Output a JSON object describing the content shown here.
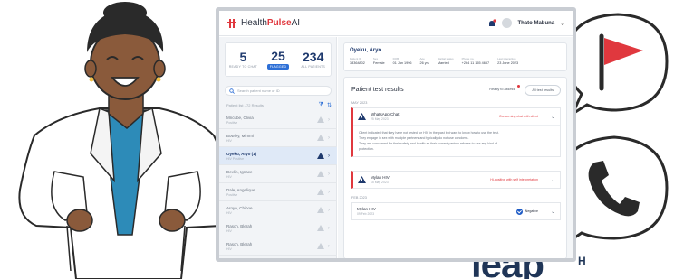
{
  "app": {
    "brand_prefix": "Health",
    "brand_highlight": "Pulse",
    "brand_suffix": " AI",
    "user_name": "Thato Mabuna"
  },
  "stats": [
    {
      "value": "5",
      "label": "Ready to chat"
    },
    {
      "value": "25",
      "label": "Flagged"
    },
    {
      "value": "234",
      "label": "All patients"
    }
  ],
  "search": {
    "placeholder": "Search patient name or ID"
  },
  "list_header": {
    "label": "Patient list - 72 Results"
  },
  "patients": [
    {
      "name": "Mncube, Olivia",
      "sub": "Positive",
      "flagged": false,
      "active": false
    },
    {
      "name": "Bowley, Mimmi",
      "sub": "HIV",
      "flagged": false,
      "active": false
    },
    {
      "name": "Oyeku, Aryo (1)",
      "sub": "HIV Positive",
      "flagged": true,
      "active": true
    },
    {
      "name": "Devlin, Ignace",
      "sub": "HIV",
      "flagged": false,
      "active": false
    },
    {
      "name": "Dale, Angelique",
      "sub": "Positive",
      "flagged": false,
      "active": false
    },
    {
      "name": "Aroyo, Chiboe",
      "sub": "HIV",
      "flagged": false,
      "active": false
    },
    {
      "name": "Rasch, Blerah",
      "sub": "HIV",
      "flagged": false,
      "active": false
    },
    {
      "name": "Rasch, Blerah",
      "sub": "HIV",
      "flagged": false,
      "active": false
    }
  ],
  "patient_card": {
    "name": "Oyeku, Aryo",
    "fields": [
      {
        "key": "Patient ID",
        "value": "38364802"
      },
      {
        "key": "Sex",
        "value": "Female"
      },
      {
        "key": "DOB",
        "value": "01 Jan 1996"
      },
      {
        "key": "Age",
        "value": "26 yrs"
      },
      {
        "key": "Marital status",
        "value": "Married"
      },
      {
        "key": "Phone no.",
        "value": "+264 11 155 4657"
      },
      {
        "key": "Last interaction",
        "value": "23 June 2023"
      }
    ]
  },
  "results": {
    "title": "Patient test results",
    "tabs": [
      {
        "label": "Ready to assess",
        "active": false
      },
      {
        "label": "All test results",
        "active": true
      }
    ],
    "sections": [
      {
        "date": "MAY 2023"
      },
      {
        "date": "FEB 2023"
      }
    ],
    "cards": [
      {
        "title": "WhatsApp Chat",
        "date": "25 May 2023",
        "flag": "Concerning chat with client",
        "body": [
          "Client indicated that they have not tested for HIV in the past but want to know how to use the test.",
          "They engage in sex with multiple partners and typically do not use condoms.",
          "They are concerned for their safety and health as their current partner refuses to use any kind of",
          "protection."
        ]
      },
      {
        "title": "Mylan HIV",
        "date": "15 May 2023",
        "flag": "Hi-positive with self interpretation"
      },
      {
        "title": "Mylan HIV",
        "date": "09 Feb 2023",
        "result": "Negative"
      }
    ]
  },
  "logo_text": "leap",
  "logo_sub": "H",
  "colors": {
    "brand_red": "#e0383e",
    "primary_blue": "#2d6fd6",
    "navy": "#1f3a6e",
    "logo_navy": "#1f3557"
  }
}
